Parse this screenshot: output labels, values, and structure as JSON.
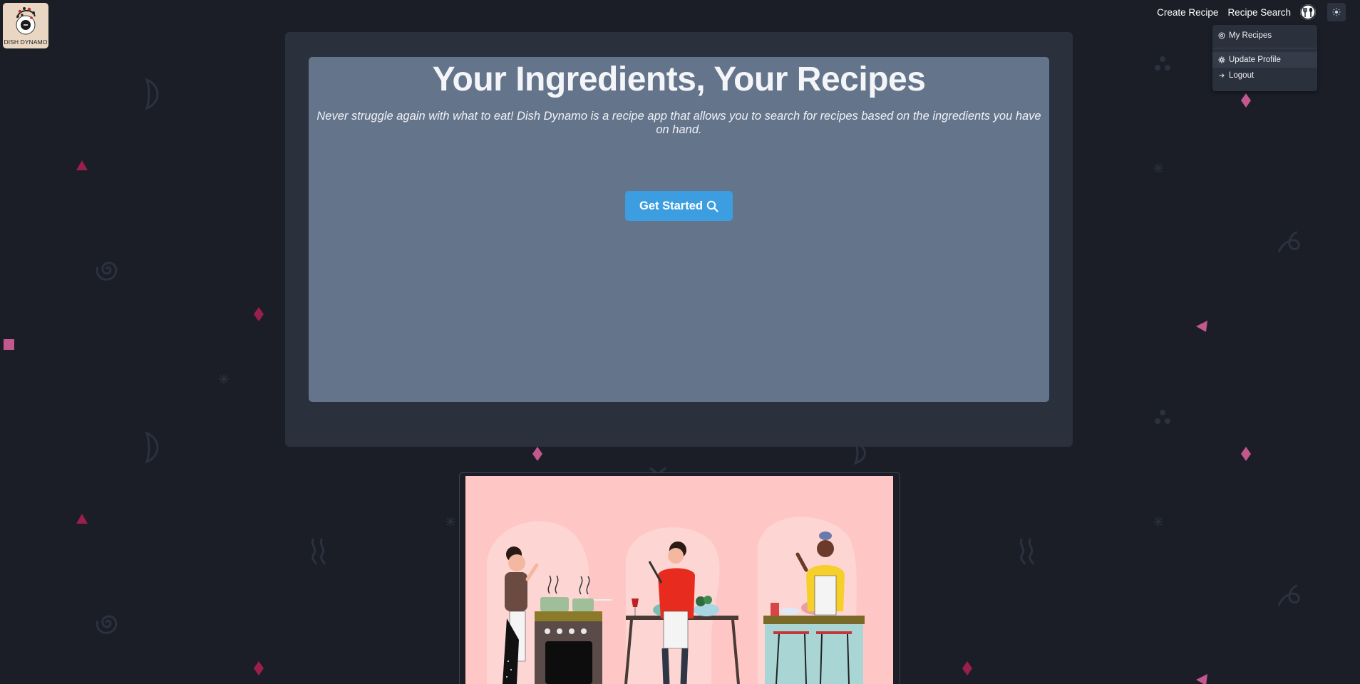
{
  "app": {
    "logo_text": "DISH DYNAMO"
  },
  "nav": {
    "create_recipe": "Create Recipe",
    "recipe_search": "Recipe Search"
  },
  "user_menu": {
    "items": [
      {
        "label": "My Recipes",
        "icon": "at-icon"
      },
      {
        "label": "Update Profile",
        "icon": "gear-icon"
      },
      {
        "label": "Logout",
        "icon": "arrow-right-icon"
      }
    ]
  },
  "hero": {
    "title": "Your Ingredients, Your Recipes",
    "subtitle": "Never struggle again with what to eat! Dish Dynamo is a recipe app that allows you to search for recipes based on the ingredients you have on hand.",
    "cta_label": "Get Started"
  },
  "colors": {
    "background": "#1b1e27",
    "card": "#2a303c",
    "hero_panel": "#64748b",
    "accent": "#3c9ee0",
    "decor_pink": "#c2457d",
    "illustration_bg": "#fec7c6"
  }
}
